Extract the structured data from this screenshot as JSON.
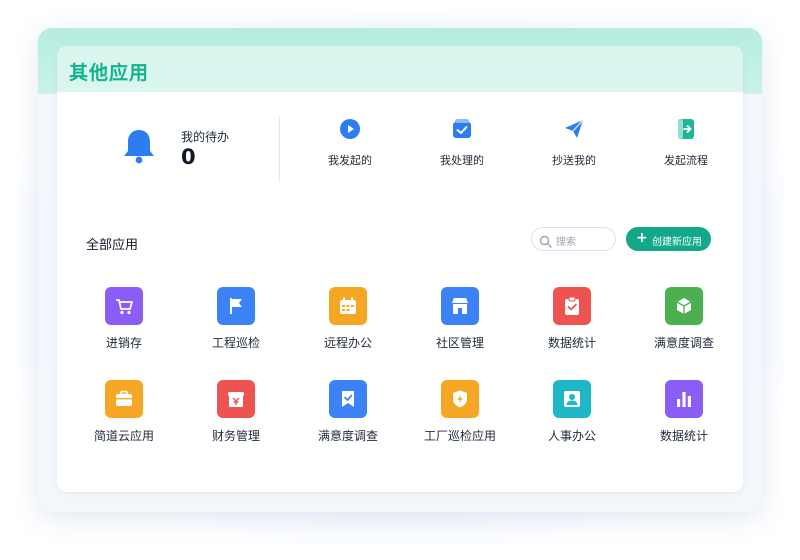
{
  "page": {
    "title": "其他应用"
  },
  "todo": {
    "label": "我的待办",
    "count": "0"
  },
  "quick_actions": [
    {
      "label": "我发起的",
      "icon": "play-circle-icon",
      "color": "#2b7df0"
    },
    {
      "label": "我处理的",
      "icon": "check-square-icon",
      "color": "#2b7df0"
    },
    {
      "label": "抄送我的",
      "icon": "paper-plane-icon",
      "color": "#2b7df0"
    },
    {
      "label": "发起流程",
      "icon": "exit-door-icon",
      "color": "#1fb59a"
    }
  ],
  "apps_section": {
    "title": "全部应用",
    "search_placeholder": "搜索",
    "create_label": "创建新应用"
  },
  "apps": [
    {
      "label": "进销存",
      "icon": "cart-icon",
      "color": "#8b5cf6"
    },
    {
      "label": "工程巡检",
      "icon": "flag-icon",
      "color": "#3b82f6"
    },
    {
      "label": "远程办公",
      "icon": "calendar-icon",
      "color": "#f5a623"
    },
    {
      "label": "社区管理",
      "icon": "store-icon",
      "color": "#3b82f6"
    },
    {
      "label": "数据统计",
      "icon": "clipboard-check-icon",
      "color": "#ef5350"
    },
    {
      "label": "满意度调查",
      "icon": "cube-icon",
      "color": "#4caf50"
    },
    {
      "label": "简道云应用",
      "icon": "briefcase-icon",
      "color": "#f5a623"
    },
    {
      "label": "财务管理",
      "icon": "yen-box-icon",
      "color": "#ef5350"
    },
    {
      "label": "满意度调查",
      "icon": "bookmark-check-icon",
      "color": "#3b82f6"
    },
    {
      "label": "工厂巡检应用",
      "icon": "shield-bolt-icon",
      "color": "#f5a623"
    },
    {
      "label": "人事办公",
      "icon": "person-card-icon",
      "color": "#1fb6c8"
    },
    {
      "label": "数据统计",
      "icon": "bar-chart-icon",
      "color": "#8b5cf6"
    }
  ],
  "colors": {
    "accent": "#13a888",
    "title": "#10b38c",
    "bell": "#2b7df0"
  }
}
